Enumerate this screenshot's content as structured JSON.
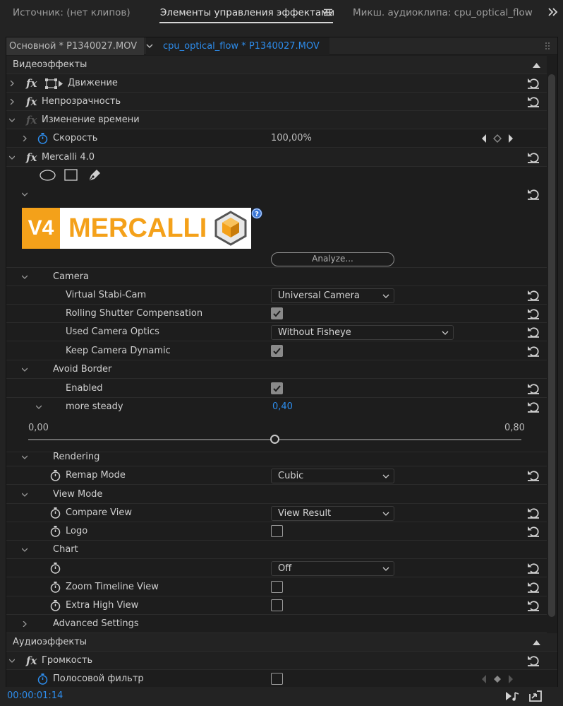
{
  "tabs": {
    "source": "Источник: (нет клипов)",
    "effects": "Элементы управления эффектами",
    "mixer": "Микш. аудиоклипа: cpu_optical_flow"
  },
  "clip_bar": {
    "master": "Основной * P1340027.MOV",
    "sequence": "cpu_optical_flow * P1340027.MOV"
  },
  "video_effects": {
    "header": "Видеоэффекты",
    "motion": "Движение",
    "opacity": "Непрозрачность",
    "time_remap": "Изменение времени",
    "speed": "Скорость",
    "speed_value": "100,00%",
    "mercalli": "Mercalli 4.0"
  },
  "logo": {
    "v4": "V4",
    "word": "MERCALLI"
  },
  "mercalli": {
    "analyze": "Analyze...",
    "camera": "Camera",
    "virtual_stabi_cam": "Virtual Stabi-Cam",
    "virtual_stabi_cam_value": "Universal Camera",
    "rolling_shutter": "Rolling Shutter Compensation",
    "used_camera_optics": "Used Camera Optics",
    "used_camera_optics_value": "Without Fisheye",
    "keep_camera_dynamic": "Keep Camera Dynamic",
    "avoid_border": "Avoid Border",
    "enabled": "Enabled",
    "more_steady": "more steady",
    "more_steady_value": "0,40",
    "slider_min": "0,00",
    "slider_max": "0,80",
    "rendering": "Rendering",
    "remap_mode": "Remap Mode",
    "remap_mode_value": "Cubic",
    "view_mode": "View Mode",
    "compare_view": "Compare View",
    "compare_view_value": "View Result",
    "logo_label": "Logo",
    "chart": "Chart",
    "chart_value": "Off",
    "zoom_timeline": "Zoom Timeline View",
    "extra_high": "Extra High View",
    "advanced": "Advanced Settings"
  },
  "audio_effects": {
    "header": "Аудиоэффекты",
    "volume": "Громкость",
    "bandpass": "Полосовой фильтр"
  },
  "footer": {
    "timecode": "00:00:01:14"
  },
  "checkboxes": {
    "rolling_shutter": true,
    "keep_camera_dynamic": true,
    "enabled": true,
    "logo": false,
    "zoom_timeline": false,
    "extra_high": false,
    "bandpass": false
  },
  "more_steady_fraction": 0.5,
  "colors": {
    "accent_blue": "#2d8ceb",
    "logo_orange": "#f4a11a",
    "panel_bg": "#1d1d1d"
  }
}
